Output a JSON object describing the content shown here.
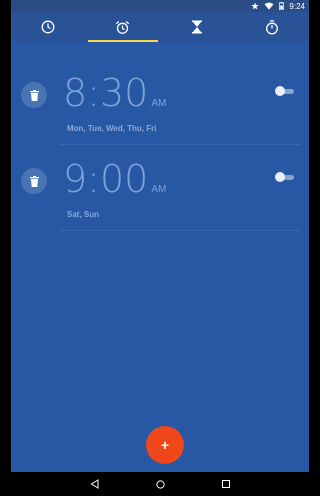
{
  "status_bar": {
    "time": "9:24",
    "icons": [
      "star-icon",
      "wifi-icon",
      "battery-icon"
    ]
  },
  "tabs": [
    {
      "name": "clock",
      "icon": "clock-icon"
    },
    {
      "name": "alarm",
      "icon": "alarm-clock-icon",
      "active": true
    },
    {
      "name": "timer",
      "icon": "hourglass-icon"
    },
    {
      "name": "stopwatch",
      "icon": "stopwatch-icon"
    }
  ],
  "alarms": [
    {
      "time": "8:30",
      "ampm": "AM",
      "days": "Mon, Tue, Wed, Thu, Fri",
      "enabled": false
    },
    {
      "time": "9:00",
      "ampm": "AM",
      "days": "Sat, Sun",
      "enabled": false
    }
  ],
  "fab": {
    "label": "+"
  },
  "nav": [
    "back-icon",
    "home-icon",
    "recents-icon"
  ],
  "colors": {
    "app_bg": "#2858a4",
    "tab_bar": "#2a5296",
    "tab_indicator": "#f5d646",
    "fab": "#f0471a",
    "time_text": "#7fa2d8"
  }
}
